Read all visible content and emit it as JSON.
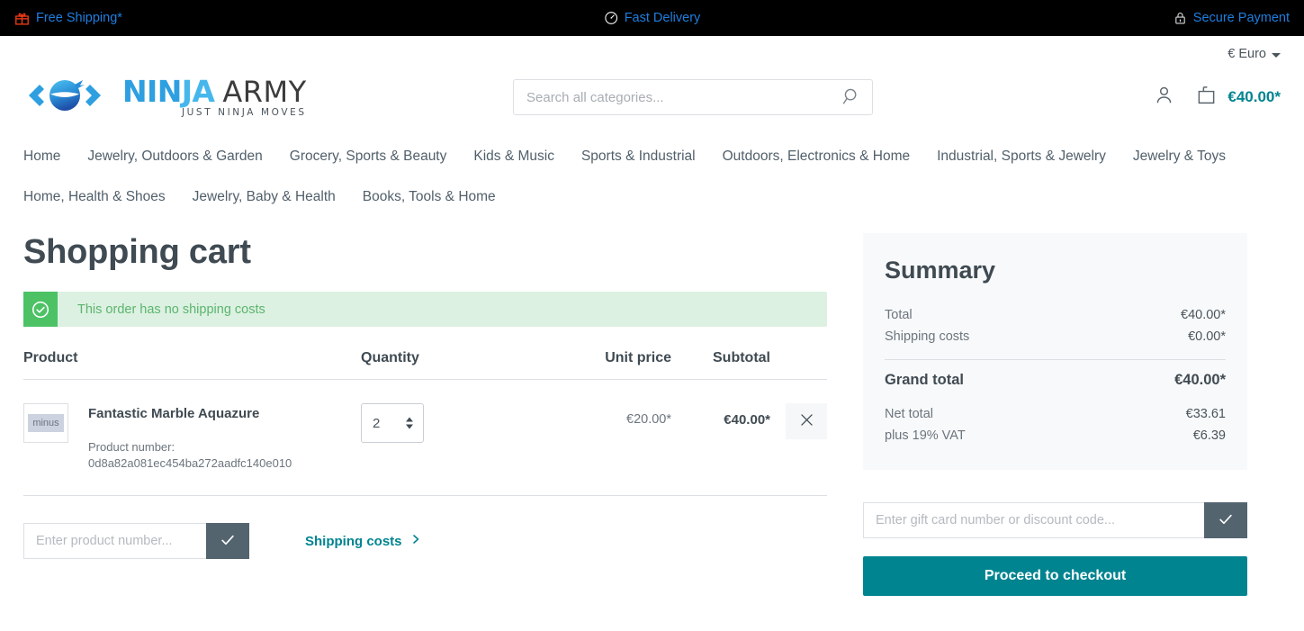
{
  "topbar": {
    "items": [
      {
        "icon": "gift-icon",
        "label": "Free Shipping*"
      },
      {
        "icon": "fast-delivery-icon",
        "label": "Fast Delivery"
      },
      {
        "icon": "lock-icon",
        "label": "Secure Payment"
      }
    ]
  },
  "header": {
    "currency": "€ Euro",
    "logo": {
      "ninja_part1": "NIN",
      "ninja_part2": "JA",
      "army": "ARMY",
      "tagline": "JUST NINJA MOVES"
    },
    "search": {
      "placeholder": "Search all categories...",
      "value": ""
    },
    "cart_amount": "€40.00*"
  },
  "nav": {
    "items": [
      "Home",
      "Jewelry, Outdoors & Garden",
      "Grocery, Sports & Beauty",
      "Kids & Music",
      "Sports & Industrial",
      "Outdoors, Electronics & Home",
      "Industrial, Sports & Jewelry",
      "Jewelry & Toys",
      "Home, Health & Shoes",
      "Jewelry, Baby & Health",
      "Books, Tools & Home"
    ]
  },
  "cart": {
    "title": "Shopping cart",
    "alert": "This order has no shipping costs",
    "columns": {
      "product": "Product",
      "quantity": "Quantity",
      "unit_price": "Unit price",
      "subtotal": "Subtotal"
    },
    "items": [
      {
        "thumb_text": "minus",
        "name": "Fantastic Marble Aquazure",
        "product_number_label": "Product number:",
        "product_number": "0d8a82a081ec454ba272aadfc140e010",
        "quantity": "2",
        "unit_price": "€20.00*",
        "subtotal": "€40.00*"
      }
    ],
    "product_number_form": {
      "placeholder": "Enter product number...",
      "value": ""
    },
    "shipping_costs_link": "Shipping costs"
  },
  "summary": {
    "title": "Summary",
    "lines": [
      {
        "label": "Total",
        "value": "€40.00*"
      },
      {
        "label": "Shipping costs",
        "value": "€0.00*"
      }
    ],
    "grand_total": {
      "label": "Grand total",
      "value": "€40.00*"
    },
    "tax_lines": [
      {
        "label": "Net total",
        "value": "€33.61"
      },
      {
        "label": "plus 19% VAT",
        "value": "€6.39"
      }
    ],
    "voucher": {
      "placeholder": "Enter gift card number or discount code...",
      "value": ""
    },
    "checkout_label": "Proceed to checkout"
  },
  "colors": {
    "accent_teal": "#008490",
    "topbar_link": "#1e7ee0",
    "alert_green": "#4cc265",
    "alert_bg": "#dcf1e1",
    "logo_blue": "#2e9fe0",
    "dark_text": "#3f4a52"
  }
}
